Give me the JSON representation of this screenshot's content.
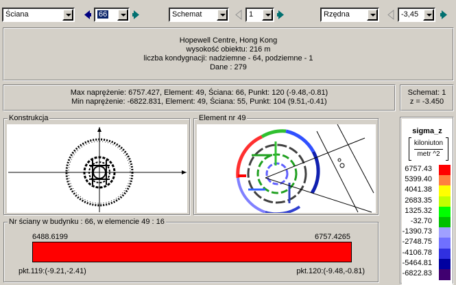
{
  "toolbar": {
    "mode_value": "Ściana",
    "wall_number": "66",
    "view_value": "Schemat",
    "schema_number": "1",
    "coord_value": "Rzędna",
    "coord_number": "-3,45"
  },
  "info": {
    "name": "Hopewell Centre, Hong Kong",
    "height": "wysokość obiektu: 216 m",
    "floors": "liczba kondygnacji: nadziemne - 64, podziemne - 1",
    "dane": "Dane :   279"
  },
  "stress": {
    "max": "Max naprężenie: 6757.427,   Element: 49,   Ściana: 66,   Punkt: 120 (-9.48,-0.81)",
    "min": "Min naprężenie: -6822.831,   Element: 49,   Ściana: 55,   Punkt: 104 (9.51,-0.41)"
  },
  "schema": {
    "line1": "Schemat: 1",
    "line2": "z = -3.450"
  },
  "konstrukcja": {
    "label": "Konstrukcja"
  },
  "element": {
    "label": "Element nr 49"
  },
  "wall": {
    "label": "Nr ściany w budynku :  66,    w elemencie 49 :  16",
    "left_value": "6488.6199",
    "right_value": "6757.4265",
    "left_point": "pkt.119:(-9.21,-2.41)",
    "right_point": "pkt.120:(-9.48,-0.81)",
    "bar_color": "#ff0000"
  },
  "legend": {
    "title": "sigma_z",
    "unit_top": "kiloniuton",
    "unit_bottom": "metr ^2",
    "items": [
      {
        "label": "6757.43",
        "color": "#ff0000"
      },
      {
        "label": "5399.40",
        "color": "#ff8040"
      },
      {
        "label": "4041.38",
        "color": "#ffff00"
      },
      {
        "label": "2683.35",
        "color": "#c0ff00"
      },
      {
        "label": "1325.32",
        "color": "#00ff00"
      },
      {
        "label": "-32.70",
        "color": "#00c000"
      },
      {
        "label": "-1390.73",
        "color": "#a0a0ff"
      },
      {
        "label": "-2748.75",
        "color": "#7070ff"
      },
      {
        "label": "-4106.78",
        "color": "#3030e0"
      },
      {
        "label": "-5464.81",
        "color": "#0000a0"
      },
      {
        "label": "-6822.83",
        "color": "#400070"
      }
    ]
  }
}
